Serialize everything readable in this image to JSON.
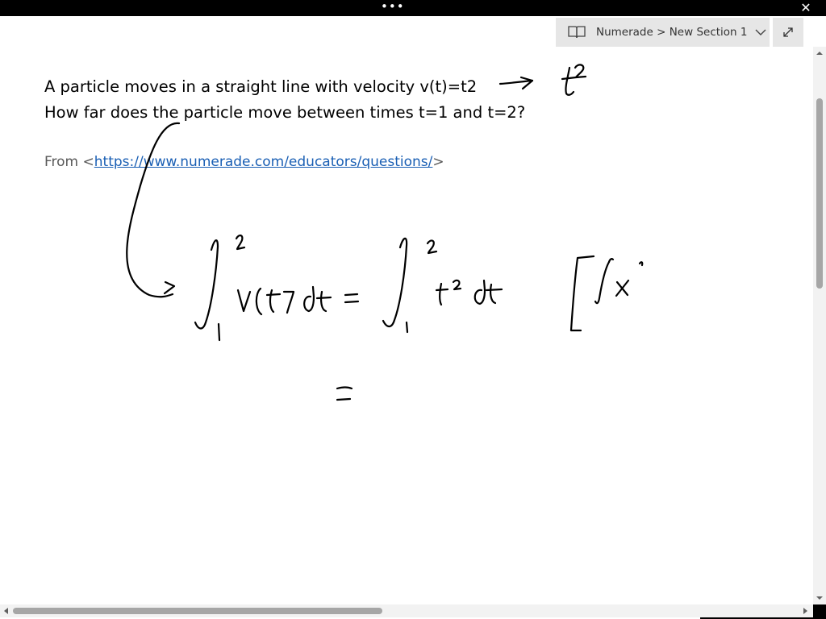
{
  "titlebar": {
    "dots": "•••",
    "close_glyph": "✕"
  },
  "notebook_picker": {
    "label": "Numerade > New Section 1",
    "icon": "notebook-icon",
    "dropdown_icon": "chevron-down-icon"
  },
  "expand_button": {
    "icon": "expand-icon"
  },
  "note": {
    "line1": "A particle moves in a straight line with velocity v(t)=t2",
    "line2": "How far does the particle move between times t=1 and t=2?",
    "from_prefix": "From <",
    "from_link": "https://www.numerade.com/educators/questions/",
    "from_suffix": ">"
  },
  "ink": {
    "annotation_t_squared": "t²",
    "integral_lhs": "∫₁² v(t) dt",
    "integral_rhs": "∫₁² t² dt",
    "bracket_note": "[∫x²",
    "equals_mark": "="
  },
  "colors": {
    "titlebar": "#000000",
    "picker_bg": "#e6e6e6",
    "link": "#1a5fb4",
    "source_text": "#595959",
    "ink": "#000000"
  }
}
